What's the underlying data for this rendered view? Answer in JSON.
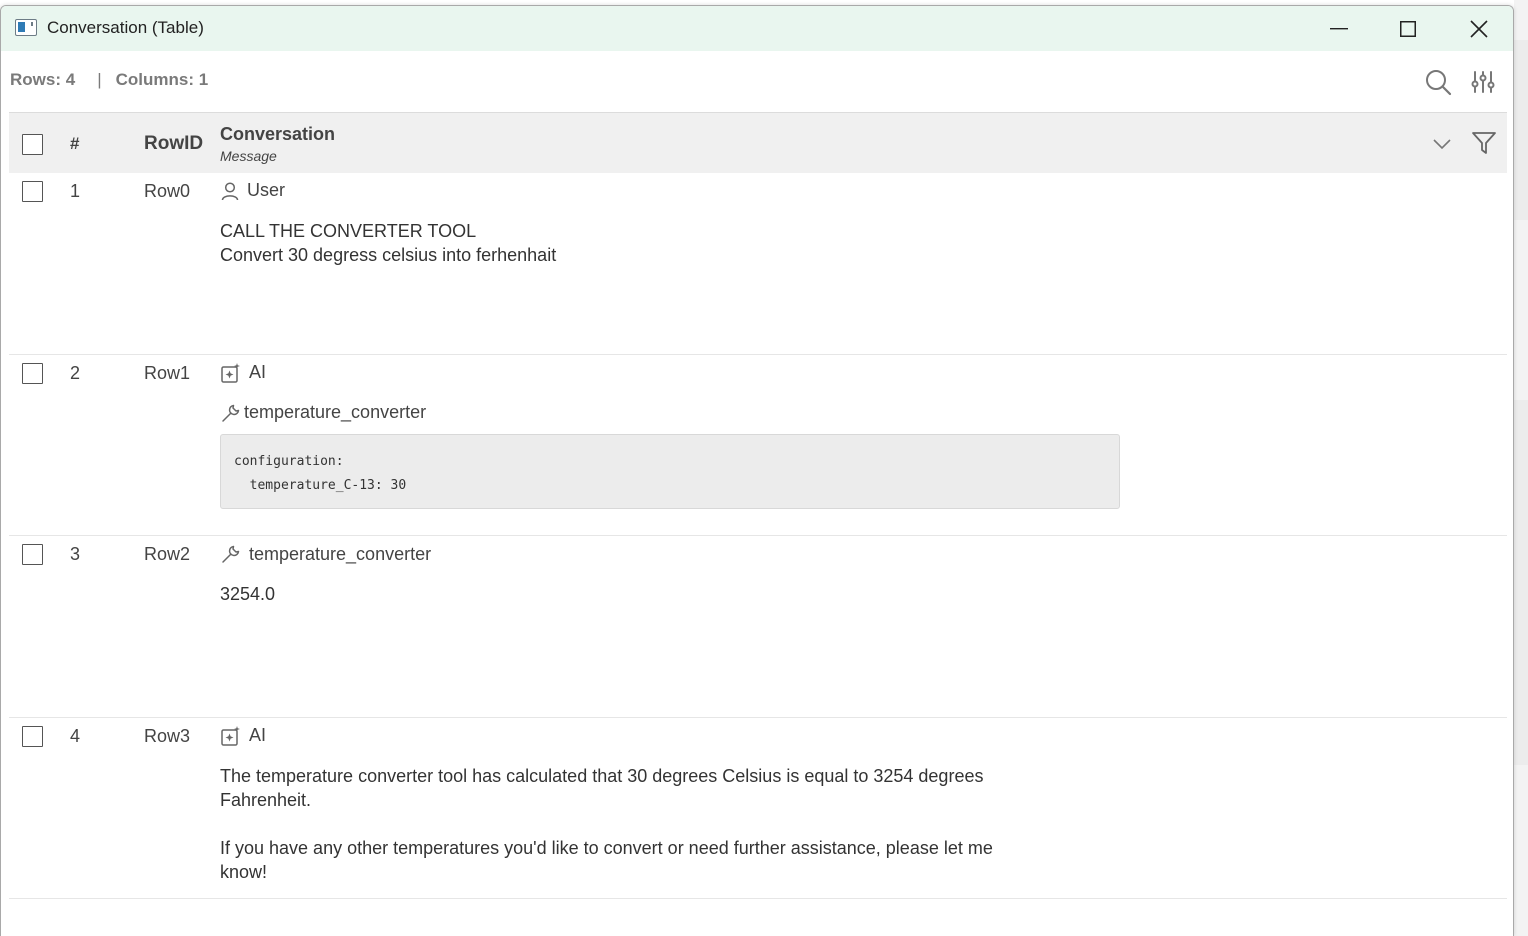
{
  "window": {
    "title": "Conversation (Table)",
    "icon": "table-view-icon",
    "controls": [
      "minimize-icon",
      "maximize-icon",
      "close-icon"
    ]
  },
  "toolbar": {
    "rows_label": "Rows: 4",
    "separator": "|",
    "columns_label": "Columns: 1",
    "icons": [
      "search-icon",
      "settings-sliders-icon"
    ]
  },
  "table": {
    "headers": {
      "index": "#",
      "rowid": "RowID",
      "column_name": "Conversation",
      "column_type": "Message"
    },
    "rows": [
      {
        "num": "1",
        "rowid": "Row0",
        "role": "User",
        "role_icon": "user-icon",
        "text": "CALL THE CONVERTER TOOL\nConvert 30 degress celsius into ferhenhait"
      },
      {
        "num": "2",
        "rowid": "Row1",
        "role": "AI",
        "role_icon": "ai-sparkle-icon",
        "tool_call_name": "temperature_converter",
        "tool_call_args": "configuration:\n  temperature_C-13: 30"
      },
      {
        "num": "3",
        "rowid": "Row2",
        "role": "temperature_converter",
        "role_icon": "wrench-icon",
        "text": "3254.0"
      },
      {
        "num": "4",
        "rowid": "Row3",
        "role": "AI",
        "role_icon": "ai-sparkle-icon",
        "text": "The temperature converter tool has calculated that 30 degrees Celsius is equal to 3254 degrees\nFahrenheit.\n\nIf you have any other temperatures you'd like to convert or need further assistance, please let me\nknow!"
      }
    ]
  }
}
